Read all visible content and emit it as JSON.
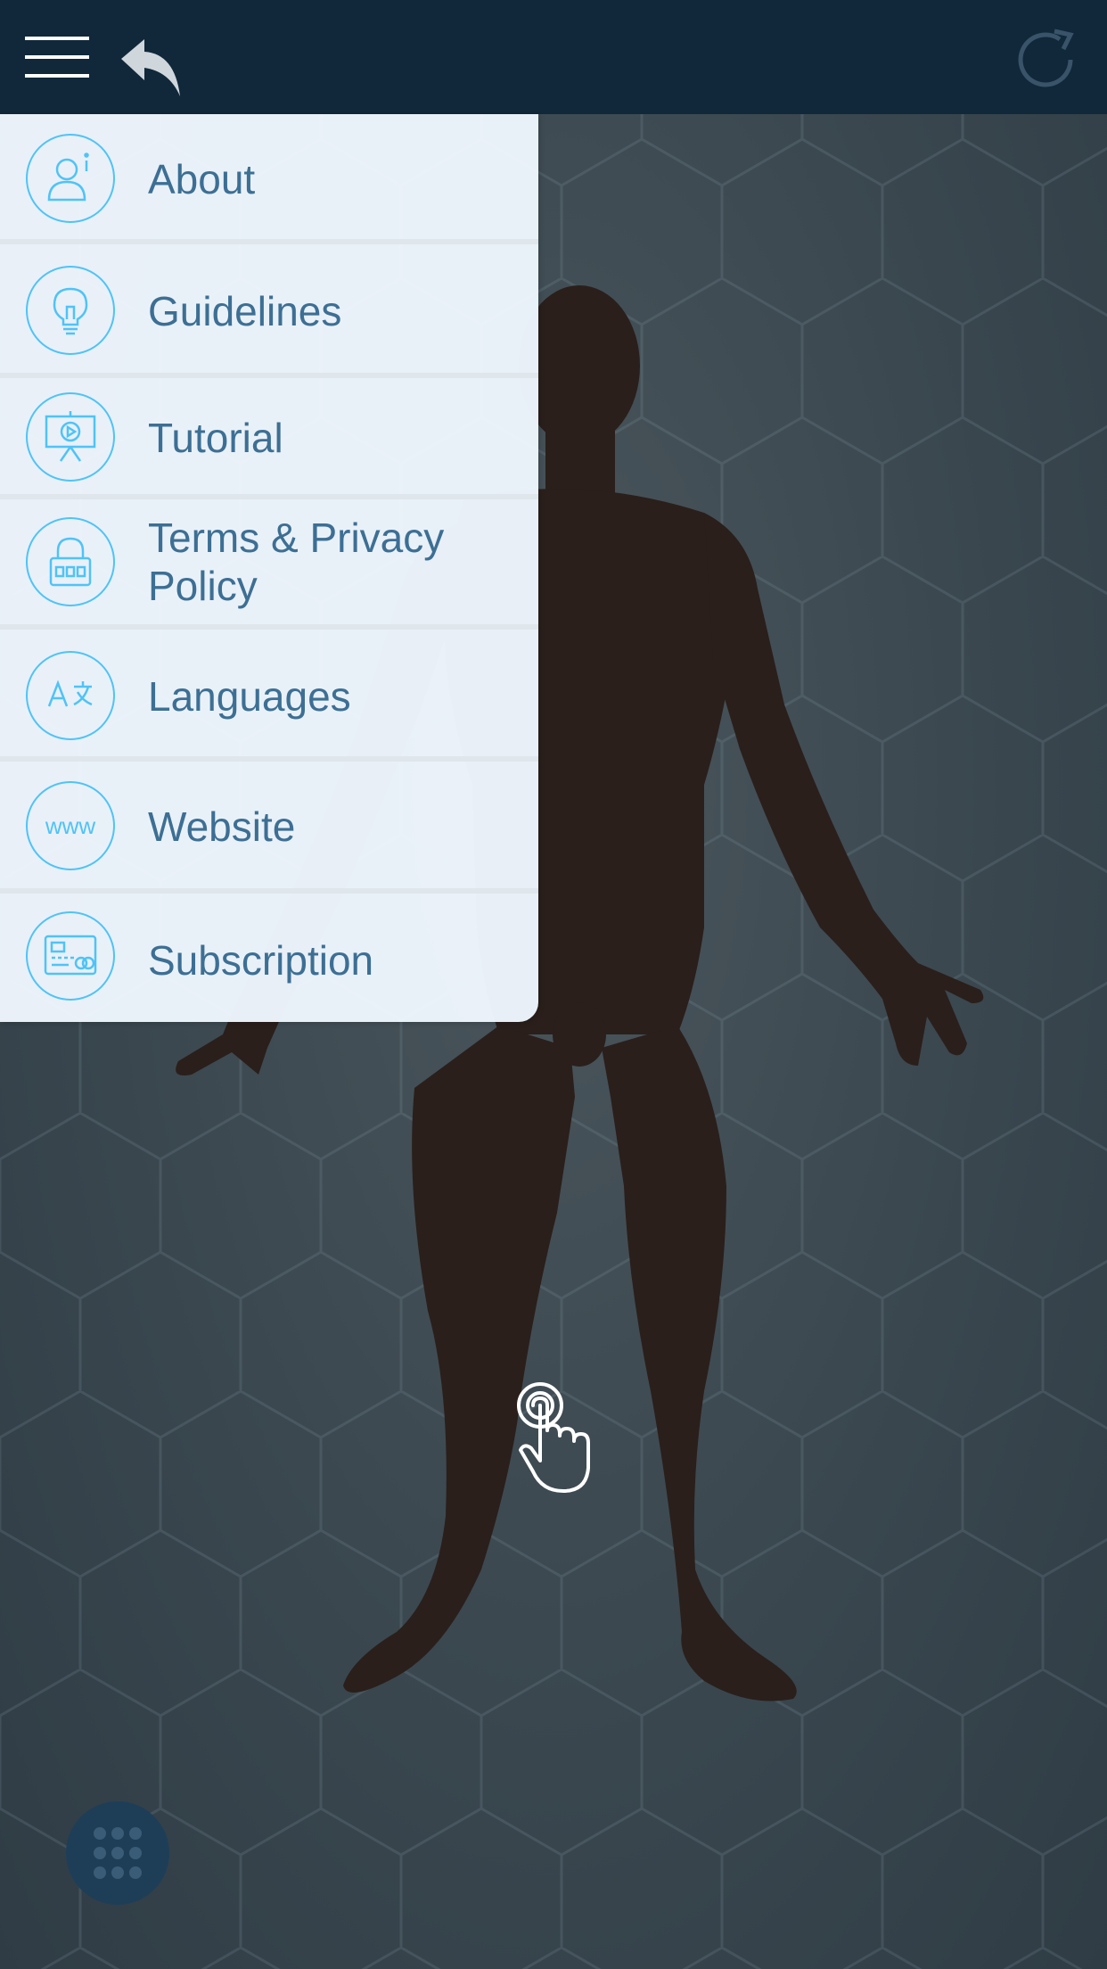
{
  "header": {
    "menu_icon": "hamburger-icon",
    "back_icon": "undo-arrow-icon",
    "refresh_icon": "refresh-icon"
  },
  "drawer": {
    "items": [
      {
        "label": "About",
        "icon": "user-info-icon"
      },
      {
        "label": "Guidelines",
        "icon": "lightbulb-icon"
      },
      {
        "label": "Tutorial",
        "icon": "presentation-play-icon"
      },
      {
        "label": "Terms  & Privacy Policy",
        "icon": "lock-icon"
      },
      {
        "label": "Languages",
        "icon": "translate-icon"
      },
      {
        "label": "Website",
        "icon": "www-icon"
      },
      {
        "label": "Subscription",
        "icon": "credit-card-icon"
      }
    ]
  },
  "canvas": {
    "model": "human-body-model",
    "tap_icon": "tap-hand-icon",
    "grid_button_icon": "dot-grid-icon"
  },
  "colors": {
    "topbar": "#10283a",
    "accent": "#4fc3f7",
    "menu_text": "#3d6f94",
    "drawer_bg": "#f0f8ff"
  }
}
